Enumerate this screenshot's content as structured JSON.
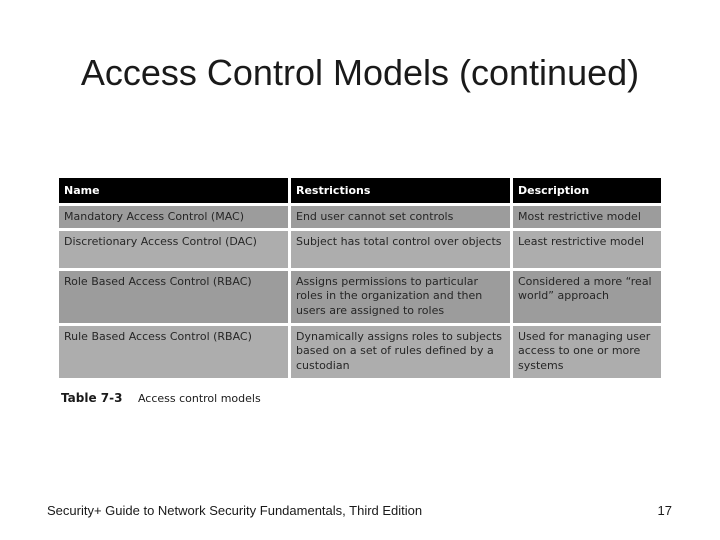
{
  "slide": {
    "title": "Access Control Models (continued)",
    "footer": "Security+ Guide to Network Security Fundamentals, Third Edition",
    "page_number": "17"
  },
  "table": {
    "headers": [
      "Name",
      "Restrictions",
      "Description"
    ],
    "rows": [
      [
        "Mandatory Access Control (MAC)",
        "End user cannot set controls",
        "Most restrictive model"
      ],
      [
        "Discretionary Access Control (DAC)",
        "Subject has total control over objects",
        "Least restrictive model"
      ],
      [
        "Role Based Access Control (RBAC)",
        "Assigns permissions to particular roles in the organization and then users are assigned to roles",
        "Considered a more “real world” approach"
      ],
      [
        "Rule Based Access Control (RBAC)",
        "Dynamically assigns roles to subjects based on a set of rules defined by a custodian",
        "Used for managing user access to one or more systems"
      ]
    ],
    "caption_label": "Table 7-3",
    "caption_text": "Access control models"
  }
}
